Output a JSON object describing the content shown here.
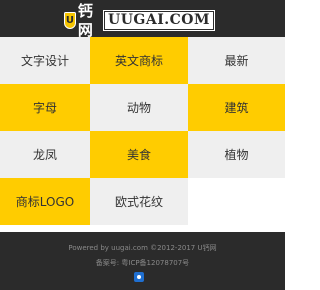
{
  "header": {
    "logo_mark": "U",
    "logo_cn": "钙网",
    "logo_en": "UUGAI.COM"
  },
  "grid": {
    "items": [
      {
        "label": "文字设计",
        "bg": "gray"
      },
      {
        "label": "英文商标",
        "bg": "yellow"
      },
      {
        "label": "最新",
        "bg": "gray"
      },
      {
        "label": "字母",
        "bg": "yellow"
      },
      {
        "label": "动物",
        "bg": "gray"
      },
      {
        "label": "建筑",
        "bg": "yellow"
      },
      {
        "label": "龙凤",
        "bg": "gray"
      },
      {
        "label": "美食",
        "bg": "yellow"
      },
      {
        "label": "植物",
        "bg": "gray"
      },
      {
        "label": "商标LOGO",
        "bg": "yellow"
      },
      {
        "label": "欧式花纹",
        "bg": "gray"
      }
    ]
  },
  "footer": {
    "powered": "Powered by uugai.com ©2012-2017 U钙网",
    "icp": "备案号: 粤ICP备12078707号"
  },
  "colors": {
    "yellow": "#ffcc00",
    "gray": "#efefef",
    "dark": "#2b2b2b"
  }
}
